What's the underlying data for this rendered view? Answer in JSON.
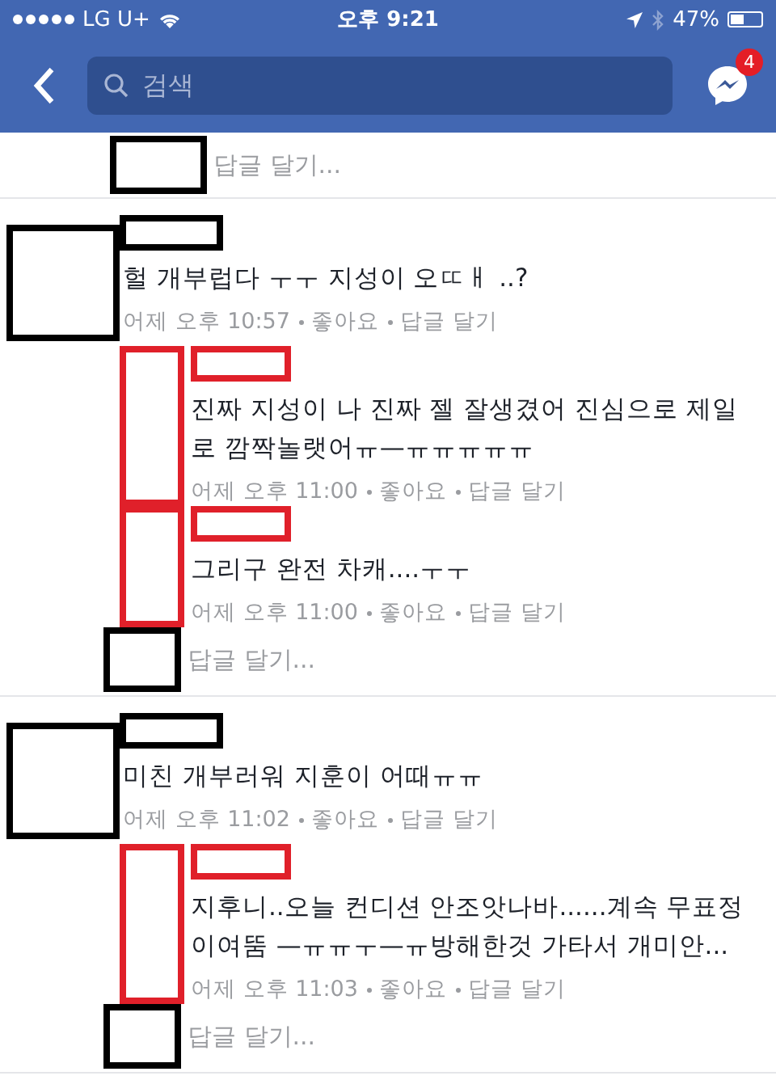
{
  "status_bar": {
    "carrier": "LG U+",
    "time": "오후 9:21",
    "battery": "47%"
  },
  "nav": {
    "search": {
      "placeholder": "검색"
    },
    "messenger_badge": "4"
  },
  "top_reply_prompt": {
    "placeholder": "답글 달기...",
    "color": "#000000"
  },
  "comments": [
    {
      "color": "#000000",
      "text": "헐 개부럽다 ㅜㅜ  지성이 오ㄸㅐ ..?",
      "time": "어제 오후 10:57",
      "like": "좋아요",
      "reply": "답글 달기",
      "replies": [
        {
          "color": "#e0202a",
          "text": "진짜 지성이 나 진짜 젤 잘생겼어 진심으로 제일로 깜짝놀랫어ㅠ—ㅠㅠㅠㅠㅠ",
          "time": "어제 오후 11:00",
          "like": "좋아요",
          "reply": "답글 달기"
        },
        {
          "color": "#e0202a",
          "text": "그리구 완전 차캐....ㅜㅜ",
          "time": "어제 오후 11:00",
          "like": "좋아요",
          "reply": "답글 달기"
        }
      ],
      "reply_prompt": {
        "placeholder": "답글 달기...",
        "color": "#000000"
      }
    },
    {
      "color": "#000000",
      "text": "미친 개부러워 지훈이 어때ㅠㅠ",
      "time": "어제 오후 11:02",
      "like": "좋아요",
      "reply": "답글 달기",
      "replies": [
        {
          "color": "#e0202a",
          "text": "지후니..오늘 컨디션 안조앗나바......계속 무표정이여뚬 —ㅠㅠㅜ—ㅠ방해한것 가타서 개미안...",
          "time": "어제 오후 11:03",
          "like": "좋아요",
          "reply": "답글 달기"
        }
      ],
      "reply_prompt": {
        "placeholder": "답글 달기...",
        "color": "#000000"
      }
    }
  ]
}
